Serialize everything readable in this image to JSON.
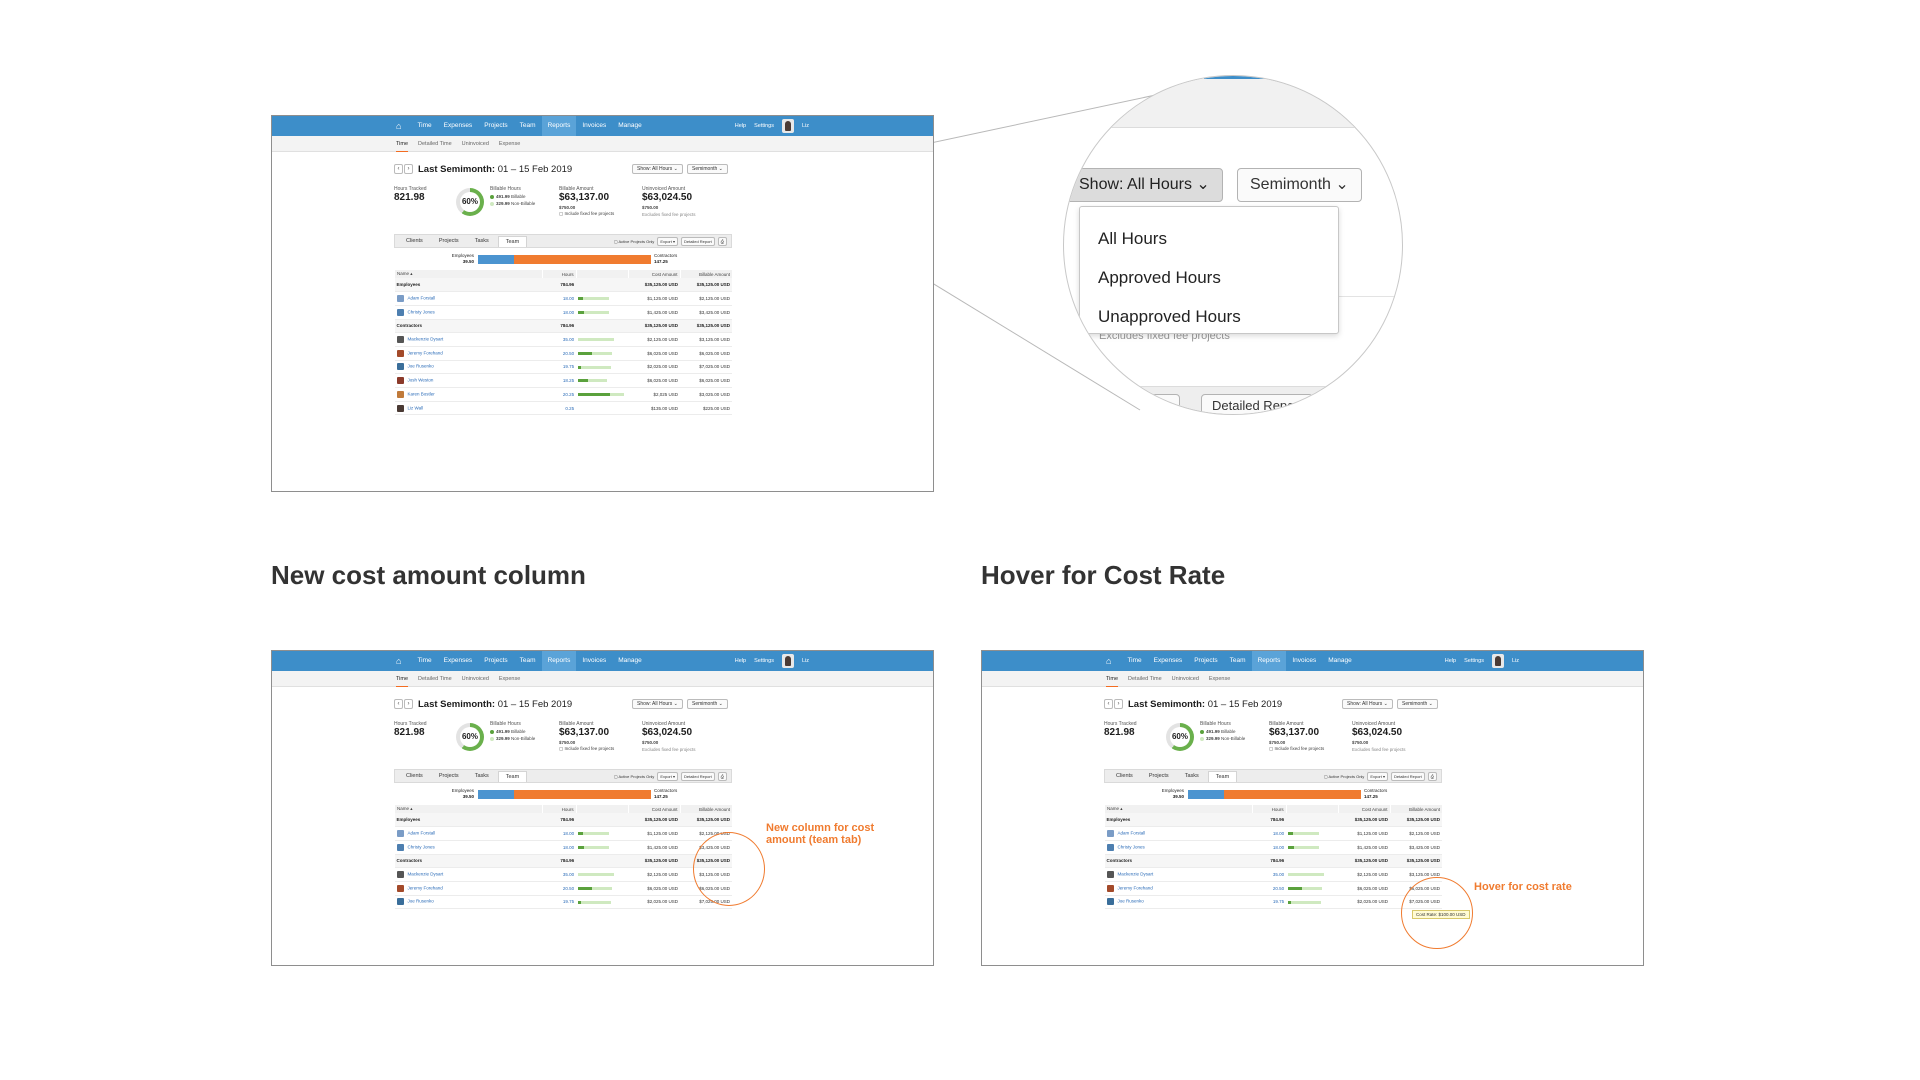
{
  "nav": {
    "items": [
      "Time",
      "Expenses",
      "Projects",
      "Team",
      "Reports",
      "Invoices",
      "Manage"
    ],
    "active": "Reports",
    "help": "Help",
    "settings": "Settings",
    "user": "Liz"
  },
  "subnav": {
    "items": [
      "Time",
      "Detailed Time",
      "Uninvoiced",
      "Expense"
    ],
    "active": "Time"
  },
  "period": {
    "title": "Last Semimonth:",
    "range": "01 – 15 Feb 2019",
    "prev": "‹",
    "next": "›",
    "show_label": "Show: All Hours",
    "semimonth_label": "Semimonth"
  },
  "summary": {
    "hours_tracked_label": "Hours Tracked",
    "hours_tracked": "821.98",
    "donut_percent": "60%",
    "billable_hours_label": "Billable Hours",
    "billable": "491.99",
    "billable_text": "Billable",
    "nonbillable": "329.99",
    "nonbillable_text": "Non-Billable",
    "billable_amount_label": "Billable Amount",
    "billable_amount": "$63,137.00",
    "billable_fixed": "$750.00",
    "include_fixed": "Include fixed fee projects",
    "uninvoiced_label": "Uninvoiced Amount",
    "uninvoiced_amount": "$63,024.50",
    "uninvoiced_fixed": "$750.00",
    "excludes_fixed": "Excludes fixed fee projects"
  },
  "tabs": [
    "Clients",
    "Projects",
    "Tasks",
    "Team"
  ],
  "active_tab": "Team",
  "tools": {
    "active_only": "Active Projects Only",
    "export": "Export",
    "detailed": "Detailed Report"
  },
  "split": {
    "employees_label": "Employees",
    "employees_hours": "39.50",
    "contractors_label": "Contractors",
    "contractors_hours": "147.25"
  },
  "table": {
    "headers": [
      "Name",
      "Hours",
      "Cost Amount",
      "Billable Amount"
    ],
    "rows": [
      {
        "kind": "group",
        "name": "Employees",
        "hours": "784.96",
        "cost": "$35,125.00 USD",
        "billable": "$35,125.00 USD"
      },
      {
        "kind": "person",
        "name": "Adam Forstall",
        "hours": "18.00",
        "cost": "$1,125.00 USD",
        "billable": "$2,125.00 USD",
        "bar": 0.65,
        "fill": 0.15
      },
      {
        "kind": "person",
        "name": "Christy Jones",
        "hours": "18.00",
        "cost": "$1,425.00 USD",
        "billable": "$3,425.00 USD",
        "bar": 0.65,
        "fill": 0.2
      },
      {
        "kind": "group",
        "name": "Contractors",
        "hours": "784.96",
        "cost": "$35,125.00 USD",
        "billable": "$35,125.00 USD"
      },
      {
        "kind": "person",
        "name": "Mackenzie Dysart",
        "hours": "35.00",
        "cost": "$2,125.00 USD",
        "billable": "$3,125.00 USD",
        "bar": 0.75,
        "fill": 0.0
      },
      {
        "kind": "person",
        "name": "Jeremy Forehand",
        "hours": "20.50",
        "cost": "$6,025.00 USD",
        "billable": "$6,025.00 USD",
        "bar": 0.7,
        "fill": 0.4
      },
      {
        "kind": "person",
        "name": "Joe Rusenko",
        "hours": "19.75",
        "cost": "$2,025.00 USD",
        "billable": "$7,025.00 USD",
        "bar": 0.68,
        "fill": 0.1
      },
      {
        "kind": "person",
        "name": "Josh Weston",
        "hours": "18.25",
        "cost": "$6,025.00 USD",
        "billable": "$6,025.00 USD",
        "bar": 0.6,
        "fill": 0.35
      },
      {
        "kind": "person",
        "name": "Karen Bostler",
        "hours": "20.25",
        "cost": "$2,025 USD",
        "billable": "$3,025.00 USD",
        "bar": 0.95,
        "fill": 0.7
      },
      {
        "kind": "person",
        "name": "Liz Wall",
        "hours": "0.25",
        "cost": "$135.00 USD",
        "billable": "$225.00 USD",
        "bar": 0,
        "fill": 0
      }
    ]
  },
  "zoom": {
    "show_label": "Show: All Hours",
    "semimonth_label": "Semimonth",
    "menu": [
      "All Hours",
      "Approved Hours",
      "Unapproved Hours"
    ],
    "faint": "Excludes fixed fee projects",
    "export": "Export",
    "detailed": "Detailed Report"
  },
  "headings": {
    "left": "New cost amount column",
    "right": "Hover for Cost Rate"
  },
  "annotations": {
    "new_column": "New column for cost amount (team tab)",
    "hover": "Hover for cost rate",
    "tooltip": "Cost Rate: $100.00 USD"
  },
  "colors": {
    "nav": "#3d8ec9",
    "accent": "#f07b2f",
    "green": "#5aa13c",
    "employees": "#4b94d0",
    "contractors": "#f07b2f"
  }
}
